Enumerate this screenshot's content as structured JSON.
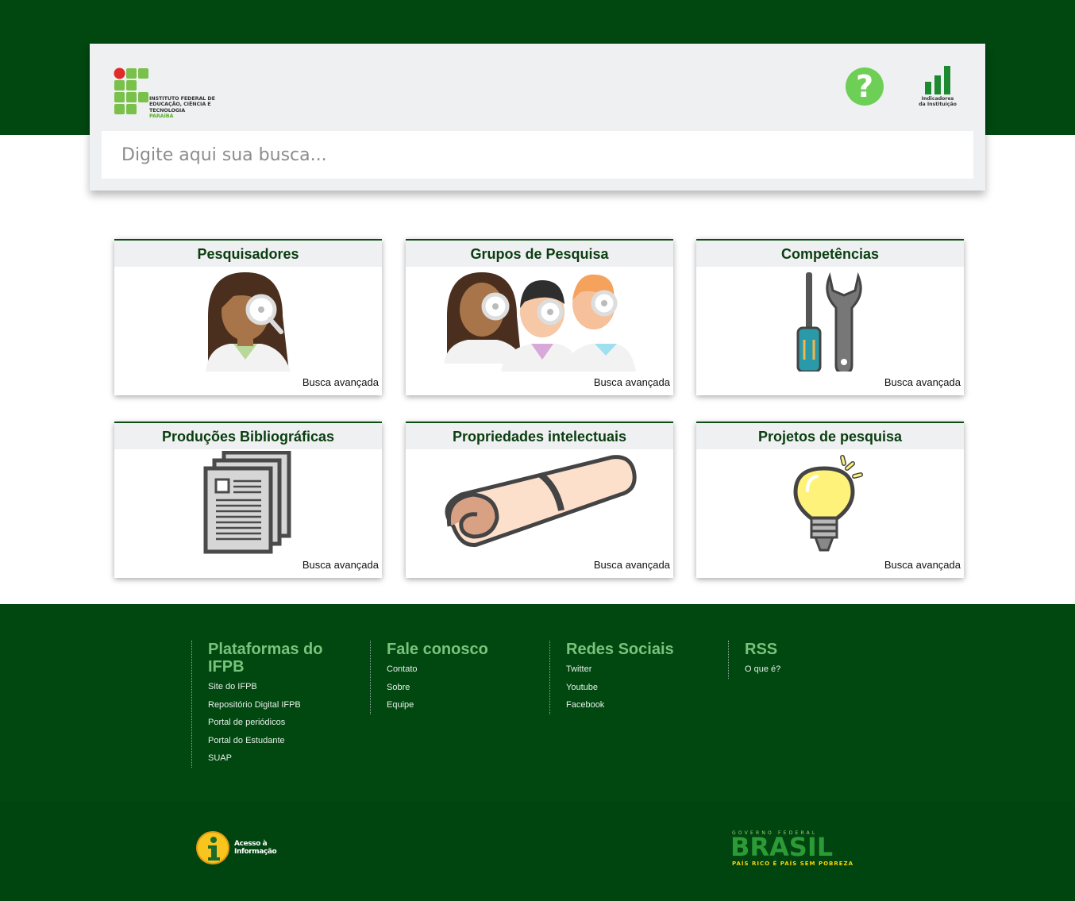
{
  "header": {
    "logo": {
      "line1": "INSTITUTO FEDERAL DE",
      "line2": "EDUCAÇÃO, CIÊNCIA E TECNOLOGIA",
      "line3": "PARAÍBA"
    },
    "help_icon": "question-mark-icon",
    "help_glyph": "?",
    "indicators": {
      "line1": "Indicadores",
      "line2": "da Instituição"
    }
  },
  "search": {
    "placeholder": "Digite aqui sua busca..."
  },
  "cards": [
    {
      "title": "Pesquisadores",
      "link": "Busca avançada",
      "icon": "researcher-icon"
    },
    {
      "title": "Grupos de Pesquisa",
      "link": "Busca avançada",
      "icon": "research-group-icon"
    },
    {
      "title": "Competências",
      "link": "Busca avançada",
      "icon": "tools-icon"
    },
    {
      "title": "Produções Bibliográficas",
      "link": "Busca avançada",
      "icon": "documents-icon"
    },
    {
      "title": "Propriedades intelectuais",
      "link": "Busca avançada",
      "icon": "scroll-icon"
    },
    {
      "title": "Projetos de pesquisa",
      "link": "Busca avançada",
      "icon": "lightbulb-icon"
    }
  ],
  "footer": {
    "columns": [
      {
        "title": "Plataformas do IFPB",
        "links": [
          "Site do IFPB",
          "Repositório Digital IFPB",
          "Portal de periódicos",
          "Portal do Estudante",
          "SUAP"
        ]
      },
      {
        "title": "Fale conosco",
        "links": [
          "Contato",
          "Sobre",
          "Equipe"
        ]
      },
      {
        "title": "Redes Sociais",
        "links": [
          "Twitter",
          "Youtube",
          "Facebook"
        ]
      },
      {
        "title": "RSS",
        "links": [
          "O que é?"
        ]
      }
    ]
  },
  "bottom": {
    "acesso": {
      "line1": "Acesso à",
      "line2": "Informação"
    },
    "brasil": {
      "top": "GOVERNO FEDERAL",
      "word": "BRASIL",
      "slogan": "PAÍS RICO É PAÍS SEM POBREZA"
    }
  },
  "colors": {
    "primary_green": "#004710",
    "accent_green": "#77c47c",
    "help_green": "#6dcf56"
  }
}
